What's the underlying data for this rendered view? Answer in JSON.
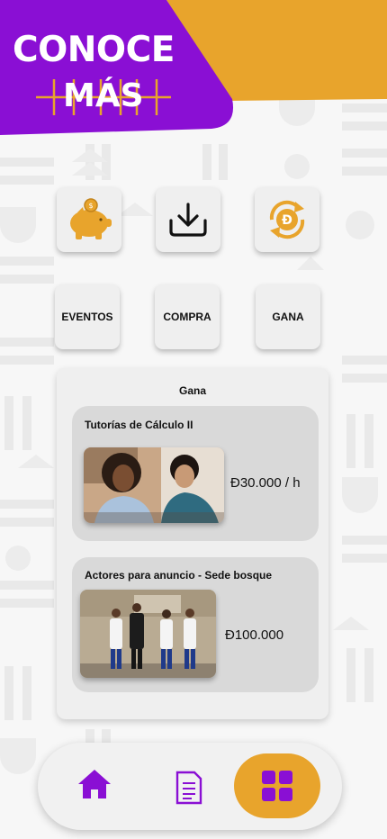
{
  "brand": {
    "title": "CONOCE",
    "subtitle": "MÁS",
    "colors": {
      "purple": "#8a0fd4",
      "gold": "#e8a42c"
    }
  },
  "quick_actions": [
    {
      "icon": "piggy-bank-icon"
    },
    {
      "icon": "download-icon"
    },
    {
      "icon": "currency-exchange-icon"
    }
  ],
  "categories": [
    {
      "label": "EVENTOS"
    },
    {
      "label": "COMPRA"
    },
    {
      "label": "GANA"
    }
  ],
  "panel": {
    "title": "Gana",
    "offers": [
      {
        "title": "Tutorías de Cálculo II",
        "price": "Đ30.000 / h"
      },
      {
        "title": "Actores para anuncio - Sede bosque",
        "price": "Đ100.000"
      }
    ]
  },
  "navbar": {
    "items": [
      {
        "icon": "home-icon"
      },
      {
        "icon": "document-icon"
      },
      {
        "icon": "grid-icon",
        "active": true
      }
    ]
  }
}
